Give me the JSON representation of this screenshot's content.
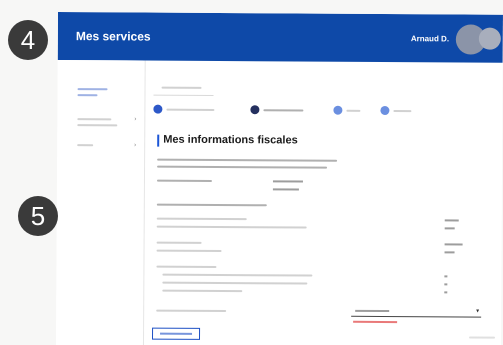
{
  "header": {
    "title": "Mes services",
    "user_name": "Arnaud D."
  },
  "main": {
    "heading": "Mes informations fiscales"
  },
  "annotations": {
    "badge_4": "4",
    "badge_5": "5"
  },
  "colors": {
    "header_bg": "#0e49a8",
    "accent": "#1c56d6",
    "badge_bg": "#3a3a3a"
  },
  "icons": {
    "avatar": "user-avatar",
    "dropdown": "chevron-down-icon"
  }
}
